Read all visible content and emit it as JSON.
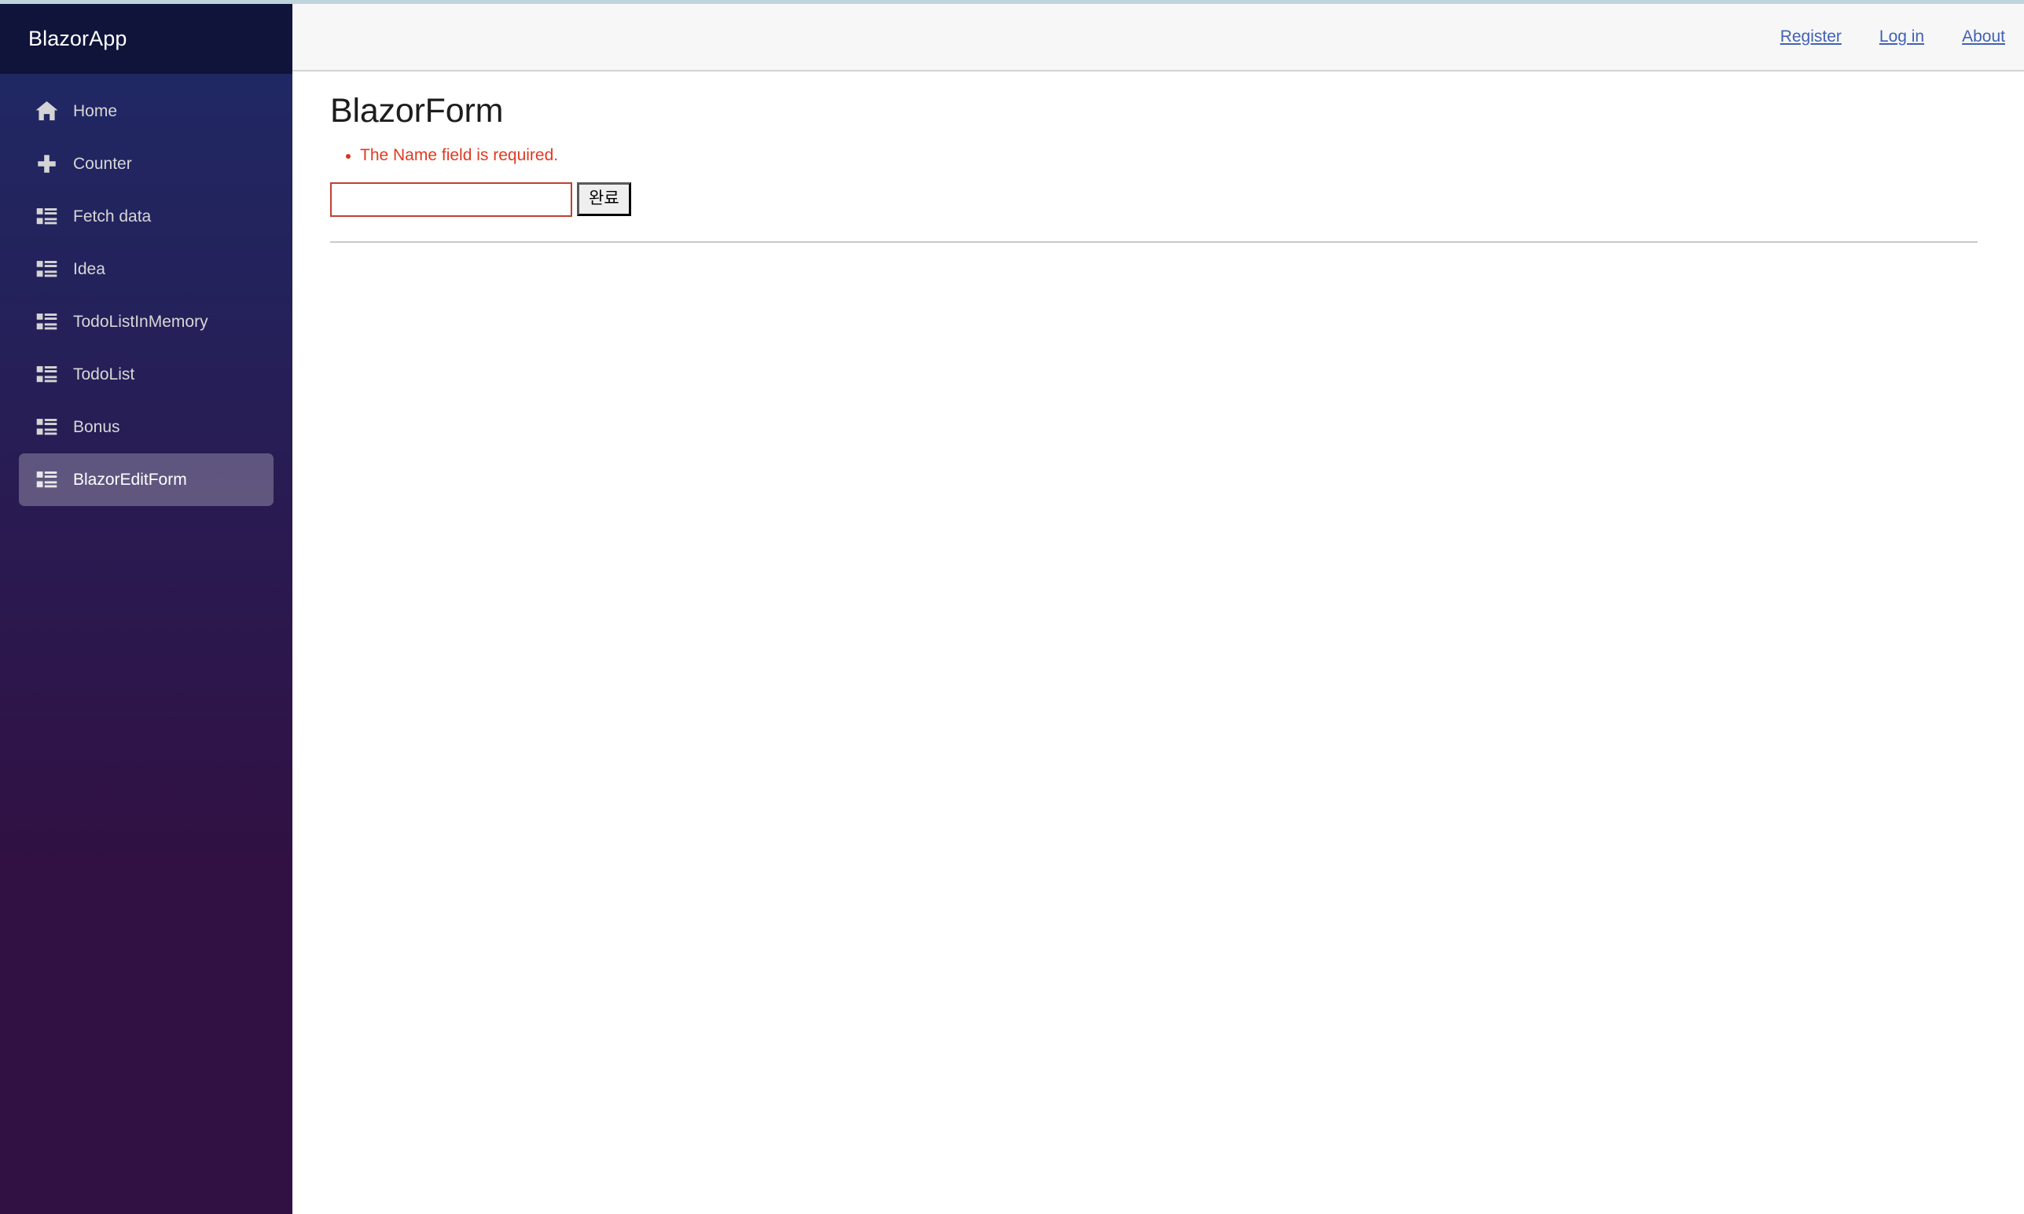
{
  "brand": {
    "name": "BlazorApp"
  },
  "sidebar": {
    "items": [
      {
        "label": "Home",
        "icon": "home-icon",
        "active": false
      },
      {
        "label": "Counter",
        "icon": "plus-icon",
        "active": false
      },
      {
        "label": "Fetch data",
        "icon": "list-rich-icon",
        "active": false
      },
      {
        "label": "Idea",
        "icon": "list-rich-icon",
        "active": false
      },
      {
        "label": "TodoListInMemory",
        "icon": "list-rich-icon",
        "active": false
      },
      {
        "label": "TodoList",
        "icon": "list-rich-icon",
        "active": false
      },
      {
        "label": "Bonus",
        "icon": "list-rich-icon",
        "active": false
      },
      {
        "label": "BlazorEditForm",
        "icon": "list-rich-icon",
        "active": true
      }
    ]
  },
  "topbar": {
    "links": [
      {
        "label": "Register"
      },
      {
        "label": "Log in"
      },
      {
        "label": "About"
      }
    ]
  },
  "main": {
    "title": "BlazorForm",
    "validation": {
      "messages": [
        "The Name field is required."
      ]
    },
    "form": {
      "name_input": {
        "value": "",
        "placeholder": ""
      },
      "submit_label": "완료"
    }
  },
  "colors": {
    "sidebar_header": "#10133a",
    "sidebar_gradient_start": "#1e2a66",
    "sidebar_gradient_end": "#311043",
    "active_item_overlay": "rgba(255,255,255,0.26)",
    "topbar_background": "#f7f7f7",
    "top_border": "#bfd4dc",
    "link": "#4161b5",
    "validation_text": "#e03a23",
    "input_border": "#bf4033",
    "divider": "#c9c9c9",
    "title_text": "#1d1d1f"
  }
}
